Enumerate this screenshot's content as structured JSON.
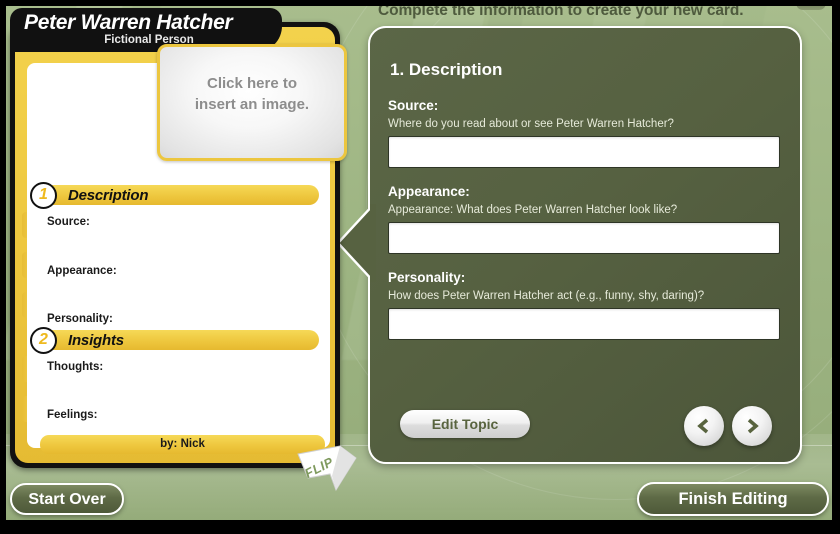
{
  "header": {
    "prompt": "Complete the information to create your new card."
  },
  "card": {
    "title": "Peter Warren Hatcher",
    "subtitle": "Fictional Person",
    "image_placeholder_line1": "Click here to",
    "image_placeholder_line2": "insert an image.",
    "sections": [
      {
        "number": "1",
        "label": "Description",
        "fields": [
          "Source:",
          "Appearance:",
          "Personality:"
        ]
      },
      {
        "number": "2",
        "label": "Insights",
        "fields": [
          "Thoughts:",
          "Feelings:"
        ]
      }
    ],
    "byline": "by: Nick",
    "flip_label": "FLIP"
  },
  "panel": {
    "title": "1. Description",
    "fields": [
      {
        "label": "Source:",
        "hint": "Where do you read about or see Peter Warren Hatcher?",
        "value": "",
        "placeholder": ""
      },
      {
        "label": "Appearance:",
        "hint": "Appearance: What does Peter Warren Hatcher look like?",
        "value": "",
        "placeholder": ""
      },
      {
        "label": "Personality:",
        "hint": "How does Peter Warren Hatcher act (e.g., funny, shy, daring)?",
        "value": "",
        "placeholder": ""
      }
    ],
    "edit_topic_label": "Edit Topic",
    "prev_icon": "chevron-left-icon",
    "next_icon": "chevron-right-icon",
    "prev_glyph": "‹",
    "next_glyph": "›"
  },
  "footer": {
    "start_over_label": "Start Over",
    "finish_editing_label": "Finish Editing"
  },
  "colors": {
    "background_green": "#9eb583",
    "panel_green": "#566141",
    "card_yellow": "#eec73e",
    "card_black": "#111111",
    "accent_white": "#ffffff",
    "button_green": "#5e6a46",
    "placeholder_gray": "#8d8d8d"
  }
}
